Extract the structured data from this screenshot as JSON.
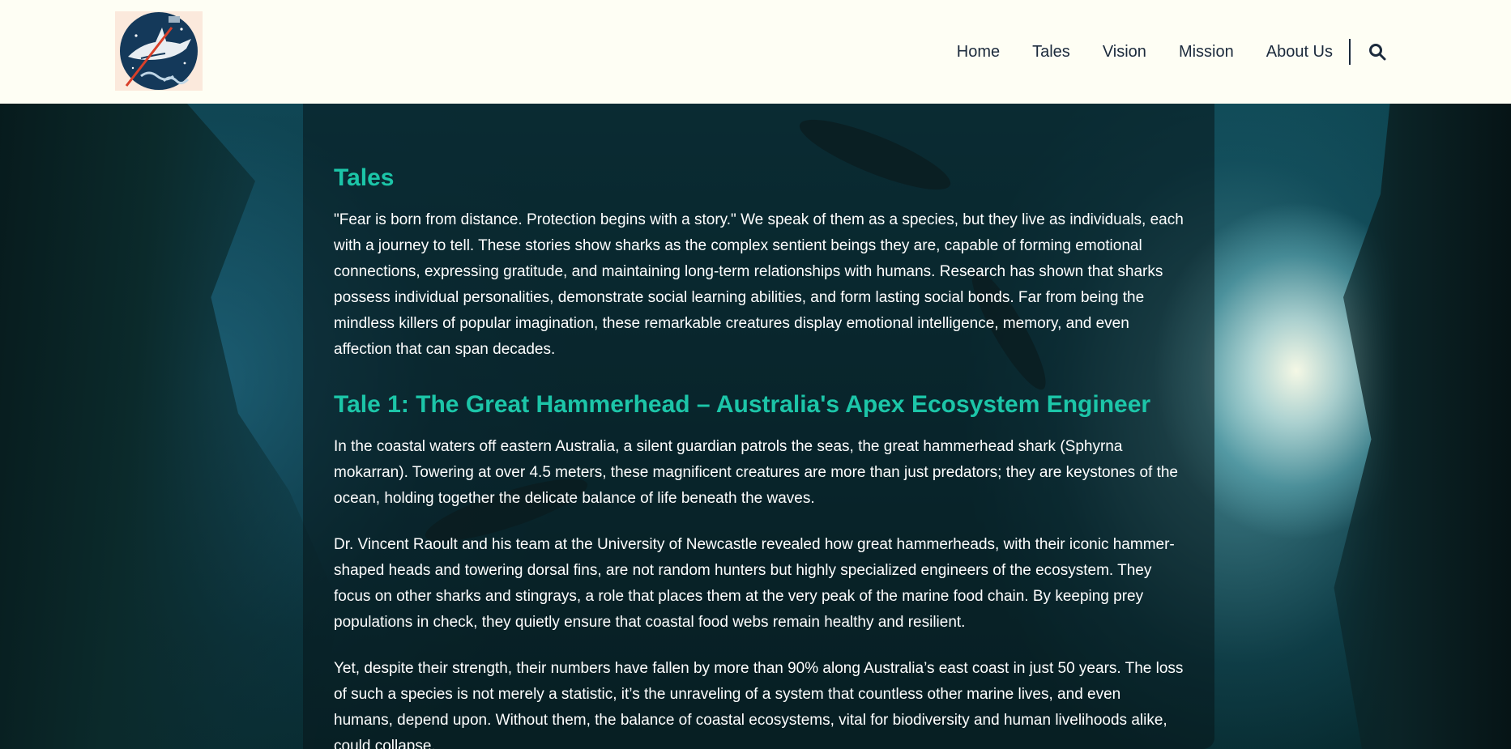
{
  "header": {
    "nav": [
      "Home",
      "Tales",
      "Vision",
      "Mission",
      "About Us"
    ],
    "search_icon": "search-icon",
    "logo_icon": "shark-logo"
  },
  "colors": {
    "heading": "#1cc5a8",
    "header_bg": "#fefef4",
    "nav_text": "#1b2a3c"
  },
  "main": {
    "title": "Tales",
    "intro": "\"Fear is born from distance. Protection begins with a story.\" We speak of them as a species, but they live as individuals, each with a journey to tell. These stories show sharks as the complex sentient beings they are, capable of forming emotional connections, expressing gratitude, and maintaining long-term relationships with humans. Research has shown that sharks possess individual personalities, demonstrate social learning abilities, and form lasting social bonds. Far from being the mindless killers of popular imagination, these remarkable creatures display emotional intelligence, memory, and even affection that can span decades.",
    "tale1_heading": "Tale 1: The Great Hammerhead – Australia's Apex Ecosystem Engineer",
    "tale1_p1": "In the coastal waters off eastern Australia, a silent guardian patrols the seas, the great hammerhead shark (Sphyrna mokarran). Towering at over 4.5 meters, these magnificent creatures are more than just predators; they are keystones of the ocean, holding together the delicate balance of life beneath the waves.",
    "tale1_p2": "Dr. Vincent Raoult and his team at the University of Newcastle revealed how great hammerheads, with their iconic hammer-shaped heads and towering dorsal fins, are not random hunters but highly specialized engineers of the ecosystem. They focus on other sharks and stingrays, a role that places them at the very peak of the marine food chain. By keeping prey populations in check, they quietly ensure that coastal food webs remain healthy and resilient.",
    "tale1_p3": "Yet, despite their strength, their numbers have fallen by more than 90% along Australia’s east coast in just 50 years. The loss of such a species is not merely a statistic, it’s the unraveling of a system that countless other marine lives, and even humans, depend upon. Without them, the balance of coastal ecosystems, vital for biodiversity and human livelihoods alike, could collapse."
  }
}
